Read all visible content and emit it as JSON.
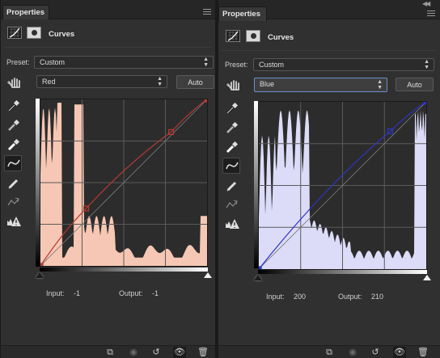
{
  "panels": [
    {
      "tab_label": "Properties",
      "title": "Curves",
      "preset_label": "Preset:",
      "preset_value": "Custom",
      "channel_value": "Red",
      "auto_label": "Auto",
      "input_label": "Input:",
      "input_value": "-1",
      "output_label": "Output:",
      "output_value": "-1",
      "curve_color": "#b43a32",
      "histogram_color": "#f6c7b4",
      "curve_points": [
        [
          0,
          0
        ],
        [
          70,
          88
        ],
        [
          200,
          205
        ],
        [
          255,
          255
        ]
      ]
    },
    {
      "tab_label": "Properties",
      "title": "Curves",
      "preset_label": "Preset:",
      "preset_value": "Custom",
      "channel_value": "Blue",
      "auto_label": "Auto",
      "input_label": "Input:",
      "input_value": "200",
      "output_label": "Output:",
      "output_value": "210",
      "curve_color": "#2d35c4",
      "histogram_color": "#dcdcf8",
      "curve_points": [
        [
          0,
          0
        ],
        [
          200,
          210
        ],
        [
          255,
          255
        ]
      ]
    }
  ],
  "tools": [
    "on-image-adjust-icon",
    "black-point-eyedropper-icon",
    "gray-point-eyedropper-icon",
    "white-point-eyedropper-icon",
    "curve-points-icon",
    "pencil-draw-icon",
    "smooth-curve-icon",
    "clipping-warning-icon"
  ],
  "footer_icons": [
    "clip-to-layer-icon",
    "view-previous-state-icon",
    "reset-icon",
    "visibility-eye-icon",
    "delete-trash-icon"
  ]
}
